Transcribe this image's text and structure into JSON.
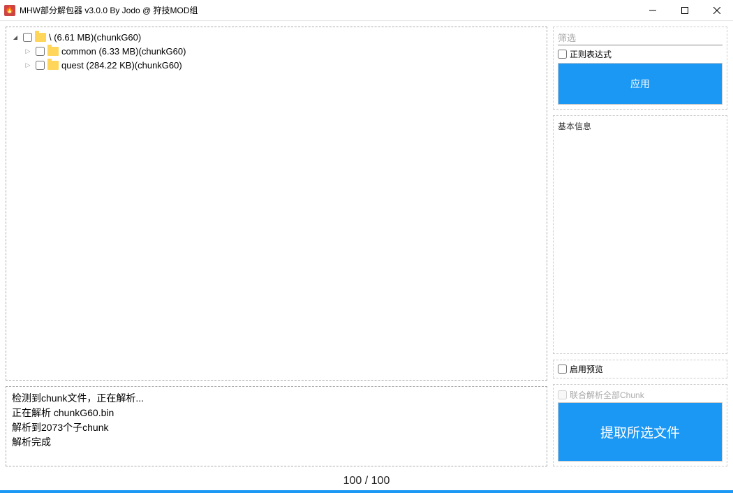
{
  "window": {
    "title": "MHW部分解包器 v3.0.0 By Jodo @ 狩技MOD组"
  },
  "tree": {
    "root": {
      "label": "\\ (6.61 MB)(chunkG60)",
      "expanded": true
    },
    "children": [
      {
        "label": "common (6.33 MB)(chunkG60)",
        "expanded": false
      },
      {
        "label": "quest (284.22 KB)(chunkG60)",
        "expanded": false
      }
    ]
  },
  "log": {
    "lines": [
      "检测到chunk文件，正在解析...",
      "正在解析 chunkG60.bin",
      "解析到2073个子chunk",
      "解析完成"
    ]
  },
  "filter": {
    "placeholder": "筛选",
    "regex_label": "正则表达式",
    "apply_label": "应用"
  },
  "info": {
    "header": "基本信息"
  },
  "preview": {
    "enable_label": "启用预览"
  },
  "extract": {
    "union_label": "联合解析全部Chunk",
    "button_label": "提取所选文件"
  },
  "progress": {
    "text": "100 / 100"
  }
}
